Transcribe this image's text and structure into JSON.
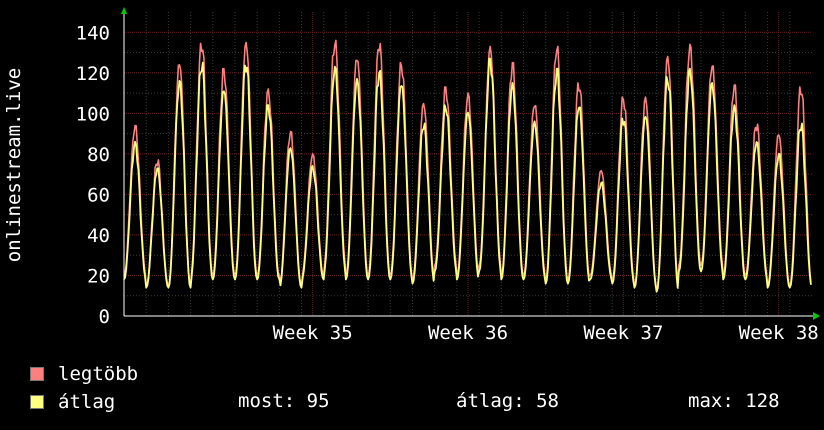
{
  "chart_data": {
    "type": "line",
    "ylabel": "onlinestream.live",
    "ylim": [
      0,
      150
    ],
    "y_ticks": [
      "0",
      "20",
      "40",
      "60",
      "80",
      "100",
      "120",
      "140"
    ],
    "x_ticks": [
      "Week 35",
      "Week 36",
      "Week 37",
      "Week 38"
    ],
    "x_tick_days": [
      8.5,
      15.5,
      22.5,
      29.5
    ],
    "x_range_days": [
      0,
      31
    ],
    "grid": true,
    "legend_placement": "bottom",
    "series": [
      {
        "name": "legtöbb",
        "color": "#ff7f7f",
        "daily_min": [
          20,
          15,
          15,
          20,
          20,
          20,
          20,
          15,
          20,
          25,
          20,
          20,
          20,
          18,
          25,
          20,
          25,
          20,
          20,
          18,
          18,
          20,
          18,
          15,
          13,
          25,
          25,
          20,
          20,
          15,
          15
        ],
        "daily_max": [
          94,
          77,
          125,
          135,
          122,
          135,
          112,
          91,
          80,
          136,
          128,
          135,
          125,
          105,
          113,
          110,
          133,
          125,
          105,
          133,
          115,
          72,
          108,
          108,
          128,
          134,
          124,
          114,
          95,
          90,
          113
        ]
      },
      {
        "name": "átlag",
        "color": "#ffff80",
        "daily_min": [
          18,
          14,
          14,
          18,
          18,
          18,
          18,
          14,
          18,
          22,
          18,
          18,
          18,
          16,
          22,
          18,
          22,
          18,
          18,
          16,
          16,
          18,
          16,
          14,
          12,
          22,
          22,
          18,
          18,
          14,
          14
        ],
        "daily_max": [
          86,
          73,
          116,
          125,
          112,
          125,
          104,
          83,
          74,
          123,
          117,
          121,
          115,
          95,
          104,
          101,
          127,
          115,
          96,
          122,
          104,
          66,
          98,
          99,
          118,
          122,
          115,
          104,
          86,
          80,
          95
        ]
      }
    ]
  },
  "legend": {
    "items": [
      {
        "label": "legtöbb",
        "color": "#ff7f7f"
      },
      {
        "label": "átlag",
        "color": "#ffff80"
      }
    ],
    "stats": {
      "now": "most: 95",
      "avg": "átlag: 58",
      "max": "max: 128"
    }
  }
}
